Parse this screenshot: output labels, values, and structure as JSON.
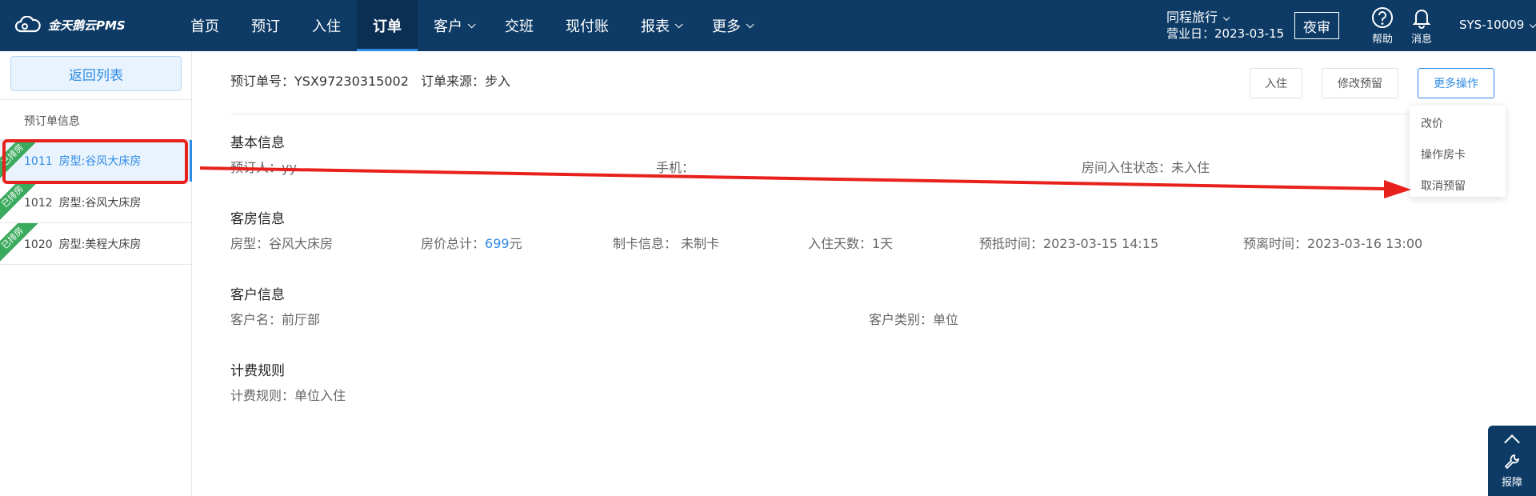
{
  "app": {
    "logo_text": "金天鹅云PMS",
    "nav": [
      {
        "label": "首页",
        "caret": false,
        "active": false
      },
      {
        "label": "预订",
        "caret": false,
        "active": false
      },
      {
        "label": "入住",
        "caret": false,
        "active": false
      },
      {
        "label": "订单",
        "caret": false,
        "active": true
      },
      {
        "label": "客户",
        "caret": true,
        "active": false
      },
      {
        "label": "交班",
        "caret": false,
        "active": false
      },
      {
        "label": "现付账",
        "caret": false,
        "active": false
      },
      {
        "label": "报表",
        "caret": true,
        "active": false
      },
      {
        "label": "更多",
        "caret": true,
        "active": false
      }
    ],
    "hotel_name": "同程旅行",
    "business_day": "营业日：2023-03-15",
    "night_audit": "夜审",
    "help": "帮助",
    "messages": "消息",
    "sys_id": "SYS-10009"
  },
  "sidebar": {
    "back_label": "返回列表",
    "section_label": "预订单信息",
    "rooms": [
      {
        "badge": "已排房",
        "number": "1011",
        "type": "房型:谷风大床房",
        "active": true
      },
      {
        "badge": "已排房",
        "number": "1012",
        "type": "房型:谷风大床房",
        "active": false
      },
      {
        "badge": "已排房",
        "number": "1020",
        "type": "房型:美程大床房",
        "active": false
      }
    ]
  },
  "order": {
    "number_label": "预订单号：YSX97230315002",
    "source_label": "订单来源：步入",
    "buttons": {
      "checkin": "入住",
      "modify": "修改预留",
      "more": "更多操作"
    },
    "more_menu": [
      "改价",
      "操作房卡",
      "取消预留"
    ]
  },
  "basic": {
    "title": "基本信息",
    "booker": "预订人：yy",
    "phone": "手机：",
    "status": "房间入住状态：未入住"
  },
  "room_info": {
    "title": "客房信息",
    "room_type": "房型：谷风大床房",
    "price_label": "房价总计：",
    "price_value": "699",
    "price_unit": "元",
    "card": "制卡信息： 未制卡",
    "nights": "入住天数：1天",
    "arrival": "预抵时间：2023-03-15 14:15",
    "departure": "预离时间：2023-03-16 13:00"
  },
  "customer": {
    "title": "客户信息",
    "name": "客户名：前厅部",
    "category": "客户类别：单位"
  },
  "billing": {
    "title": "计费规则",
    "rule": "计费规则：单位入住"
  },
  "float": {
    "repair": "报障"
  },
  "colors": {
    "nav_bg": "#0d3b66",
    "accent": "#2f8be6",
    "ribbon": "#3aaa5c",
    "annotation": "#e8211c"
  }
}
